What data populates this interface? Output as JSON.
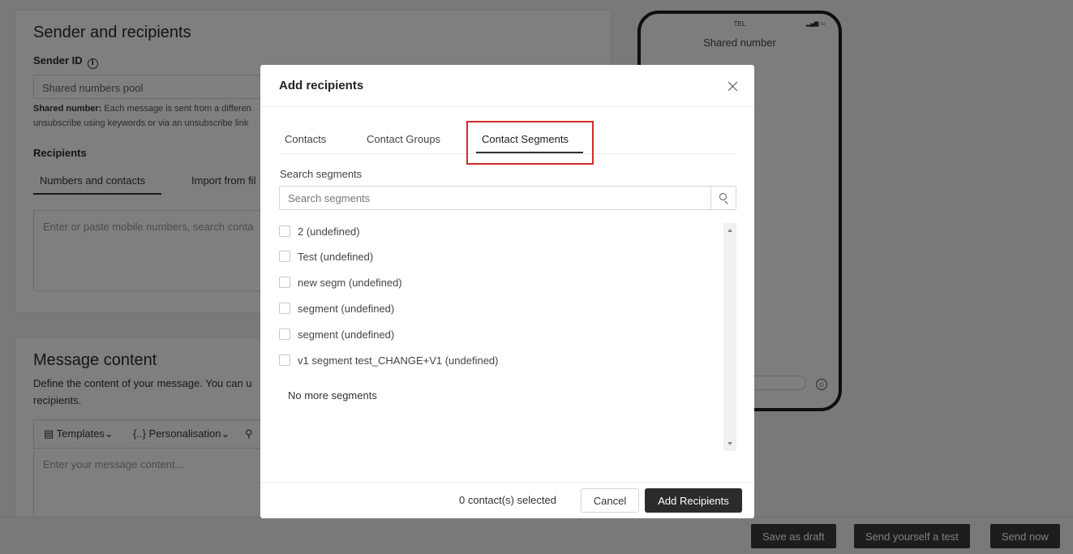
{
  "background": {
    "sender_section": {
      "title": "Sender and recipients",
      "sender_id_label": "Sender ID",
      "sender_id_value": "Shared numbers pool",
      "help_bold": "Shared number:",
      "help_line1": " Each message is sent from a differen",
      "help_line2": "unsubscribe using keywords or via an unsubscribe link",
      "recipients_label": "Recipients",
      "tab_numbers": "Numbers and contacts",
      "tab_import": "Import from fil",
      "recipients_placeholder": "Enter or paste mobile numbers, search conta"
    },
    "message_section": {
      "title": "Message content",
      "desc_line1": "Define the content of your message. You can u",
      "desc_line2": "recipients.",
      "toolbar_templates": "Templates",
      "toolbar_personalisation": "Personalisation",
      "content_placeholder": "Enter your message content..."
    },
    "phone": {
      "carrier": "TEL",
      "title": "Shared number"
    },
    "footer": {
      "save_draft": "Save as draft",
      "send_test": "Send yourself a test",
      "send_now": "Send now"
    }
  },
  "modal": {
    "title": "Add recipients",
    "tabs": [
      {
        "label": "Contacts",
        "active": false
      },
      {
        "label": "Contact Groups",
        "active": false
      },
      {
        "label": "Contact Segments",
        "active": true
      }
    ],
    "search_label": "Search segments",
    "search_placeholder": "Search segments",
    "segments": [
      {
        "label": "2 (undefined)",
        "checked": false
      },
      {
        "label": "Test (undefined)",
        "checked": false
      },
      {
        "label": "new segm (undefined)",
        "checked": false
      },
      {
        "label": "segment (undefined)",
        "checked": false
      },
      {
        "label": "segment (undefined)",
        "checked": false
      },
      {
        "label": "v1 segment test_CHANGE+V1 (undefined)",
        "checked": false
      }
    ],
    "no_more_text": "No more segments",
    "selected_count": "0 contact(s) selected",
    "cancel_label": "Cancel",
    "add_label": "Add Recipients"
  },
  "colors": {
    "highlight_border": "#d42a2a",
    "primary_button": "#2b2b2b",
    "overlay": "rgba(0,0,0,0.5)"
  }
}
